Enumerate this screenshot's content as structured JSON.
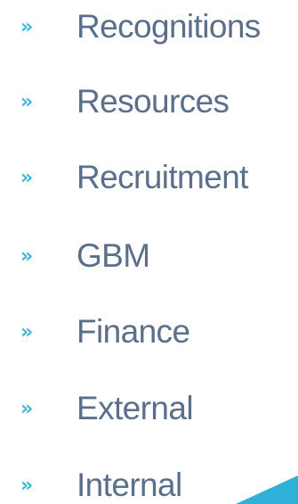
{
  "theme": {
    "label_color": "#5b6f8a",
    "chevron_color": "#3fb4d6",
    "accent_color": "#2fb0d8"
  },
  "nav": {
    "chevron_glyph": "»",
    "items": [
      {
        "label": "Recognitions"
      },
      {
        "label": "Resources"
      },
      {
        "label": "Recruitment"
      },
      {
        "label": "GBM"
      },
      {
        "label": "Finance"
      },
      {
        "label": "External"
      },
      {
        "label": "Internal"
      }
    ]
  },
  "icons": {
    "chevron": "double-chevron-right-icon",
    "corner": "corner-triangle-decoration"
  }
}
